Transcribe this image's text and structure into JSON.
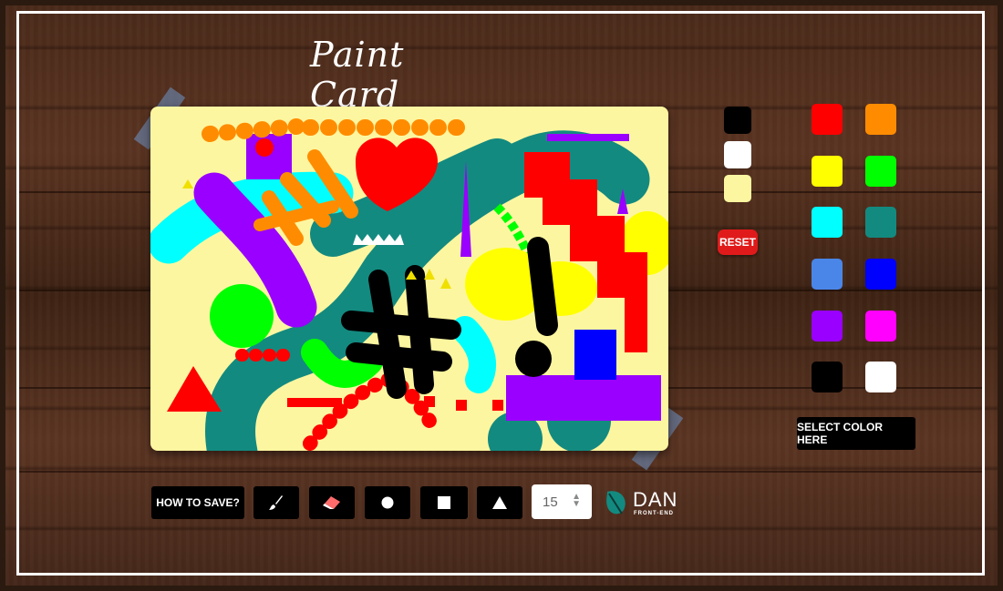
{
  "app": {
    "title": "Paint Card"
  },
  "palette": {
    "basic": [
      {
        "name": "black",
        "color": "#000000"
      },
      {
        "name": "white",
        "color": "#ffffff"
      },
      {
        "name": "cream",
        "color": "#fdf6a0"
      }
    ],
    "reset_label": "RESET",
    "colors": [
      {
        "name": "red",
        "color": "#ff0000"
      },
      {
        "name": "orange",
        "color": "#ff8c00"
      },
      {
        "name": "yellow",
        "color": "#ffff00"
      },
      {
        "name": "green",
        "color": "#00ff00"
      },
      {
        "name": "cyan",
        "color": "#00ffff"
      },
      {
        "name": "teal",
        "color": "#138a80"
      },
      {
        "name": "cornflower",
        "color": "#4a86e8"
      },
      {
        "name": "blue",
        "color": "#0000ff"
      },
      {
        "name": "purple",
        "color": "#9900ff"
      },
      {
        "name": "magenta",
        "color": "#ff00ff"
      },
      {
        "name": "black",
        "color": "#000000"
      },
      {
        "name": "white",
        "color": "#ffffff"
      }
    ],
    "select_color_label": "SELECT COLOR HERE"
  },
  "toolbar": {
    "how_to_save_label": "HOW TO SAVE?",
    "tools": [
      {
        "name": "brush",
        "icon": "brush-icon"
      },
      {
        "name": "eraser",
        "icon": "eraser-icon"
      },
      {
        "name": "circle",
        "icon": "circle-icon"
      },
      {
        "name": "square",
        "icon": "square-icon"
      },
      {
        "name": "triangle",
        "icon": "triangle-icon"
      }
    ],
    "brush_size": "15"
  },
  "logo": {
    "name": "DAN",
    "subtitle": "FRONT-END"
  }
}
